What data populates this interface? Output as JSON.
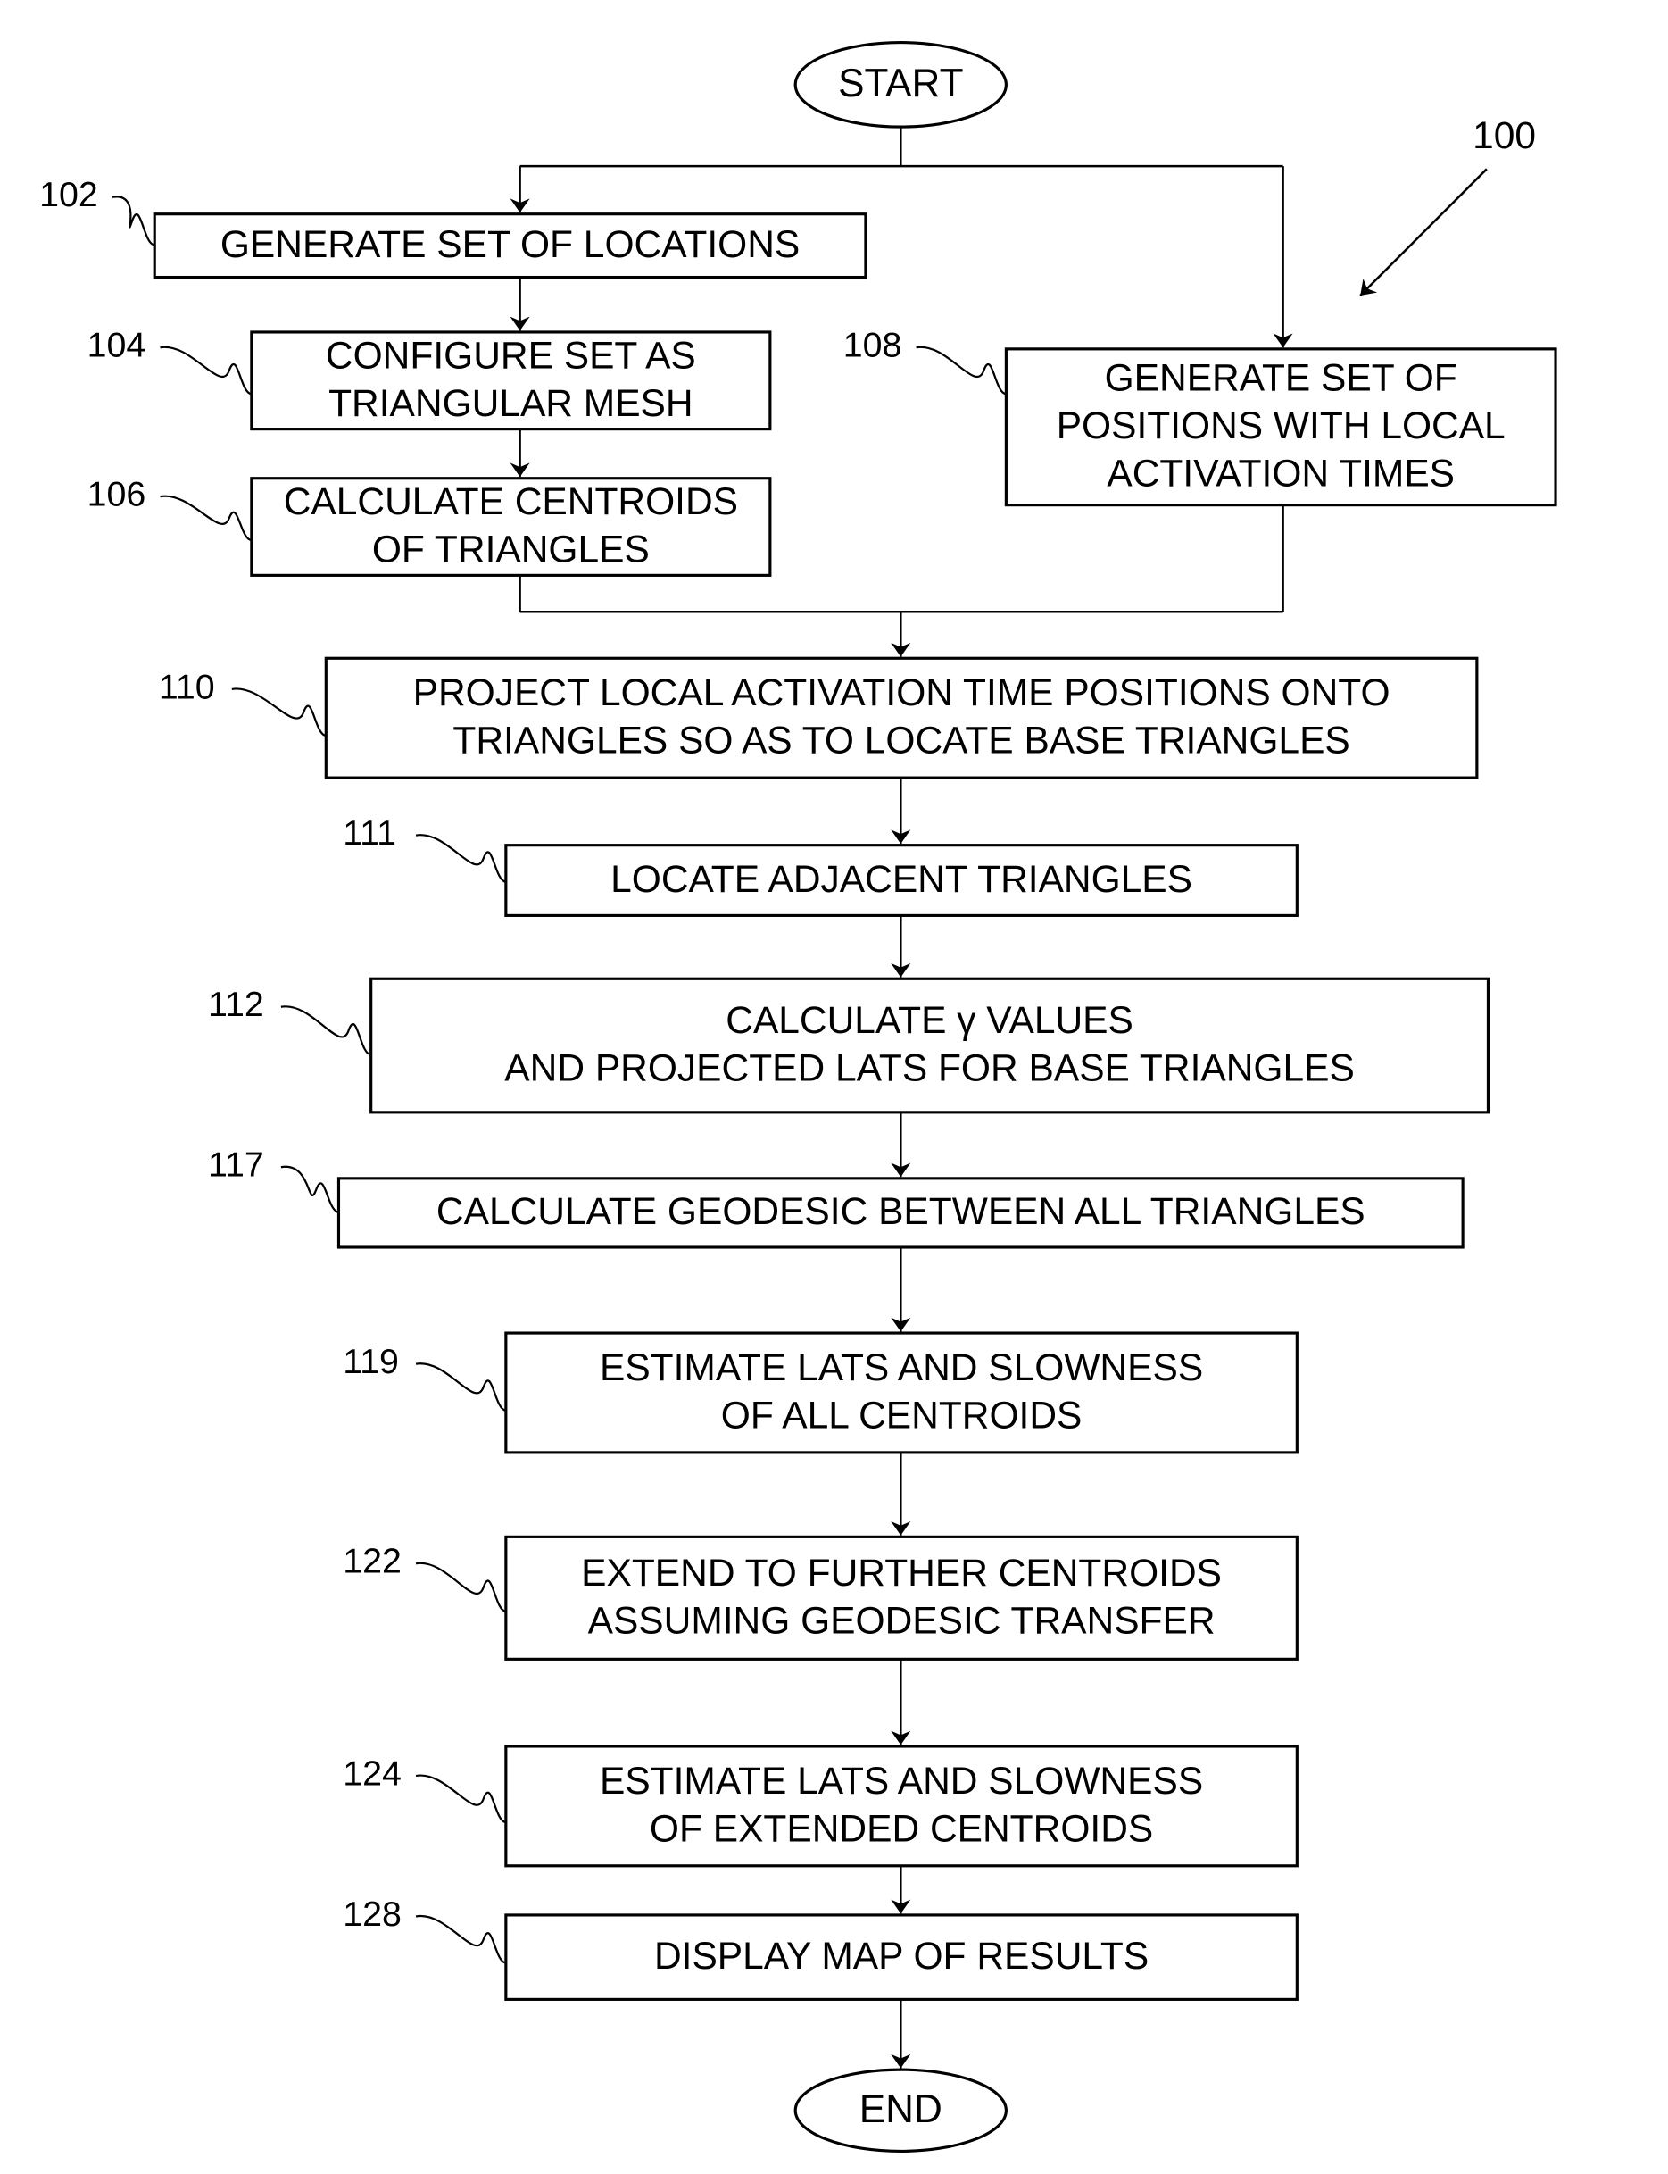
{
  "figure": {
    "reference": "100",
    "start_label": "START",
    "end_label": "END",
    "steps": [
      {
        "id": "102",
        "lines": [
          "GENERATE SET OF LOCATIONS"
        ]
      },
      {
        "id": "104",
        "lines": [
          "CONFIGURE SET AS",
          "TRIANGULAR MESH"
        ]
      },
      {
        "id": "106",
        "lines": [
          "CALCULATE CENTROIDS",
          "OF TRIANGLES"
        ]
      },
      {
        "id": "108",
        "lines": [
          "GENERATE SET OF",
          "POSITIONS WITH LOCAL",
          "ACTIVATION TIMES"
        ]
      },
      {
        "id": "110",
        "lines": [
          "PROJECT LOCAL ACTIVATION TIME POSITIONS ONTO",
          "TRIANGLES SO AS TO LOCATE BASE TRIANGLES"
        ]
      },
      {
        "id": "111",
        "lines": [
          "LOCATE ADJACENT TRIANGLES"
        ]
      },
      {
        "id": "112",
        "lines": [
          "CALCULATE γ VALUES",
          "AND PROJECTED LATS FOR BASE TRIANGLES"
        ]
      },
      {
        "id": "117",
        "lines": [
          "CALCULATE GEODESIC BETWEEN ALL TRIANGLES"
        ]
      },
      {
        "id": "119",
        "lines": [
          "ESTIMATE LATS AND SLOWNESS",
          "OF ALL CENTROIDS"
        ]
      },
      {
        "id": "122",
        "lines": [
          "EXTEND TO FURTHER CENTROIDS",
          "ASSUMING GEODESIC TRANSFER"
        ]
      },
      {
        "id": "124",
        "lines": [
          "ESTIMATE LATS AND SLOWNESS",
          "OF EXTENDED CENTROIDS"
        ]
      },
      {
        "id": "128",
        "lines": [
          "DISPLAY MAP OF RESULTS"
        ]
      }
    ]
  }
}
